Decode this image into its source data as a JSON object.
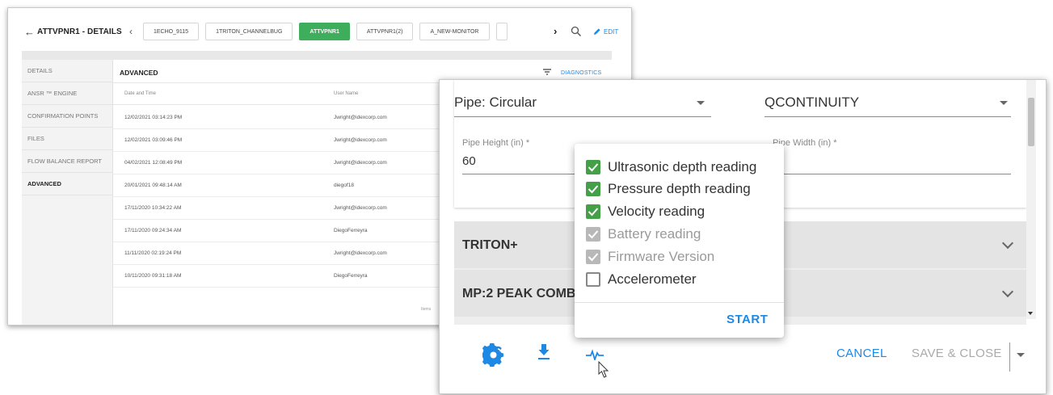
{
  "details_window": {
    "title": "ATTVPNR1 - DETAILS",
    "tabs": [
      "1ECHO_9115",
      "1TRITON_CHANNELBUG",
      "ATTVPNR1",
      "ATTVPNR1(2)",
      "A_NEW-MONITOR"
    ],
    "active_tab": "ATTVPNR1",
    "edit_label": "EDIT",
    "sidebar": [
      "DETAILS",
      "ANSR ™ ENGINE",
      "CONFIRMATION POINTS",
      "FILES",
      "FLOW BALANCE REPORT",
      "ADVANCED"
    ],
    "active_sidebar": "ADVANCED",
    "section_title": "ADVANCED",
    "diagnostics_link": "DIAGNOSTICS",
    "columns": [
      "Date and Time",
      "User Name"
    ],
    "rows": [
      {
        "datetime": "12/02/2021 03:14:23 PM",
        "user": "Jwright@idexcorp.com"
      },
      {
        "datetime": "12/02/2021 03:09:46 PM",
        "user": "Jwright@idexcorp.com"
      },
      {
        "datetime": "04/02/2021 12:08:49 PM",
        "user": "Jwright@idexcorp.com"
      },
      {
        "datetime": "20/01/2021 09:48:14 AM",
        "user": "diegof18"
      },
      {
        "datetime": "17/11/2020 10:34:22 AM",
        "user": "Jwright@idexcorp.com"
      },
      {
        "datetime": "17/11/2020 09:24:34 AM",
        "user": "DiegoFerreyra"
      },
      {
        "datetime": "11/11/2020 02:19:24 PM",
        "user": "Jwright@idexcorp.com"
      },
      {
        "datetime": "10/11/2020 09:31:18 AM",
        "user": "DiegoFerreyra"
      }
    ],
    "items_note": "Items"
  },
  "edit_dialog": {
    "pipe_shape_value": "Pipe: Circular",
    "second_dropdown_value": "QCONTINUITY",
    "pipe_height_label": "Pipe Height (in) *",
    "pipe_height_value": "60",
    "pipe_width_label": "Pipe Width (in) *",
    "panels": [
      "TRITON+",
      "MP:2 PEAK COMB"
    ],
    "cancel_label": "CANCEL",
    "save_close_label": "SAVE & CLOSE"
  },
  "diagnostics_popup": {
    "options": [
      {
        "label": "Ultrasonic depth reading",
        "state": "checked"
      },
      {
        "label": "Pressure depth reading",
        "state": "checked"
      },
      {
        "label": "Velocity reading",
        "state": "checked"
      },
      {
        "label": "Battery reading",
        "state": "checked-disabled"
      },
      {
        "label": "Firmware Version",
        "state": "checked-disabled"
      },
      {
        "label": "Accelerometer",
        "state": "unchecked"
      }
    ],
    "start_label": "START"
  },
  "colors": {
    "accent_blue": "#1e88e5",
    "active_tab_green": "#3ead5c",
    "checkbox_green": "#43a047"
  }
}
